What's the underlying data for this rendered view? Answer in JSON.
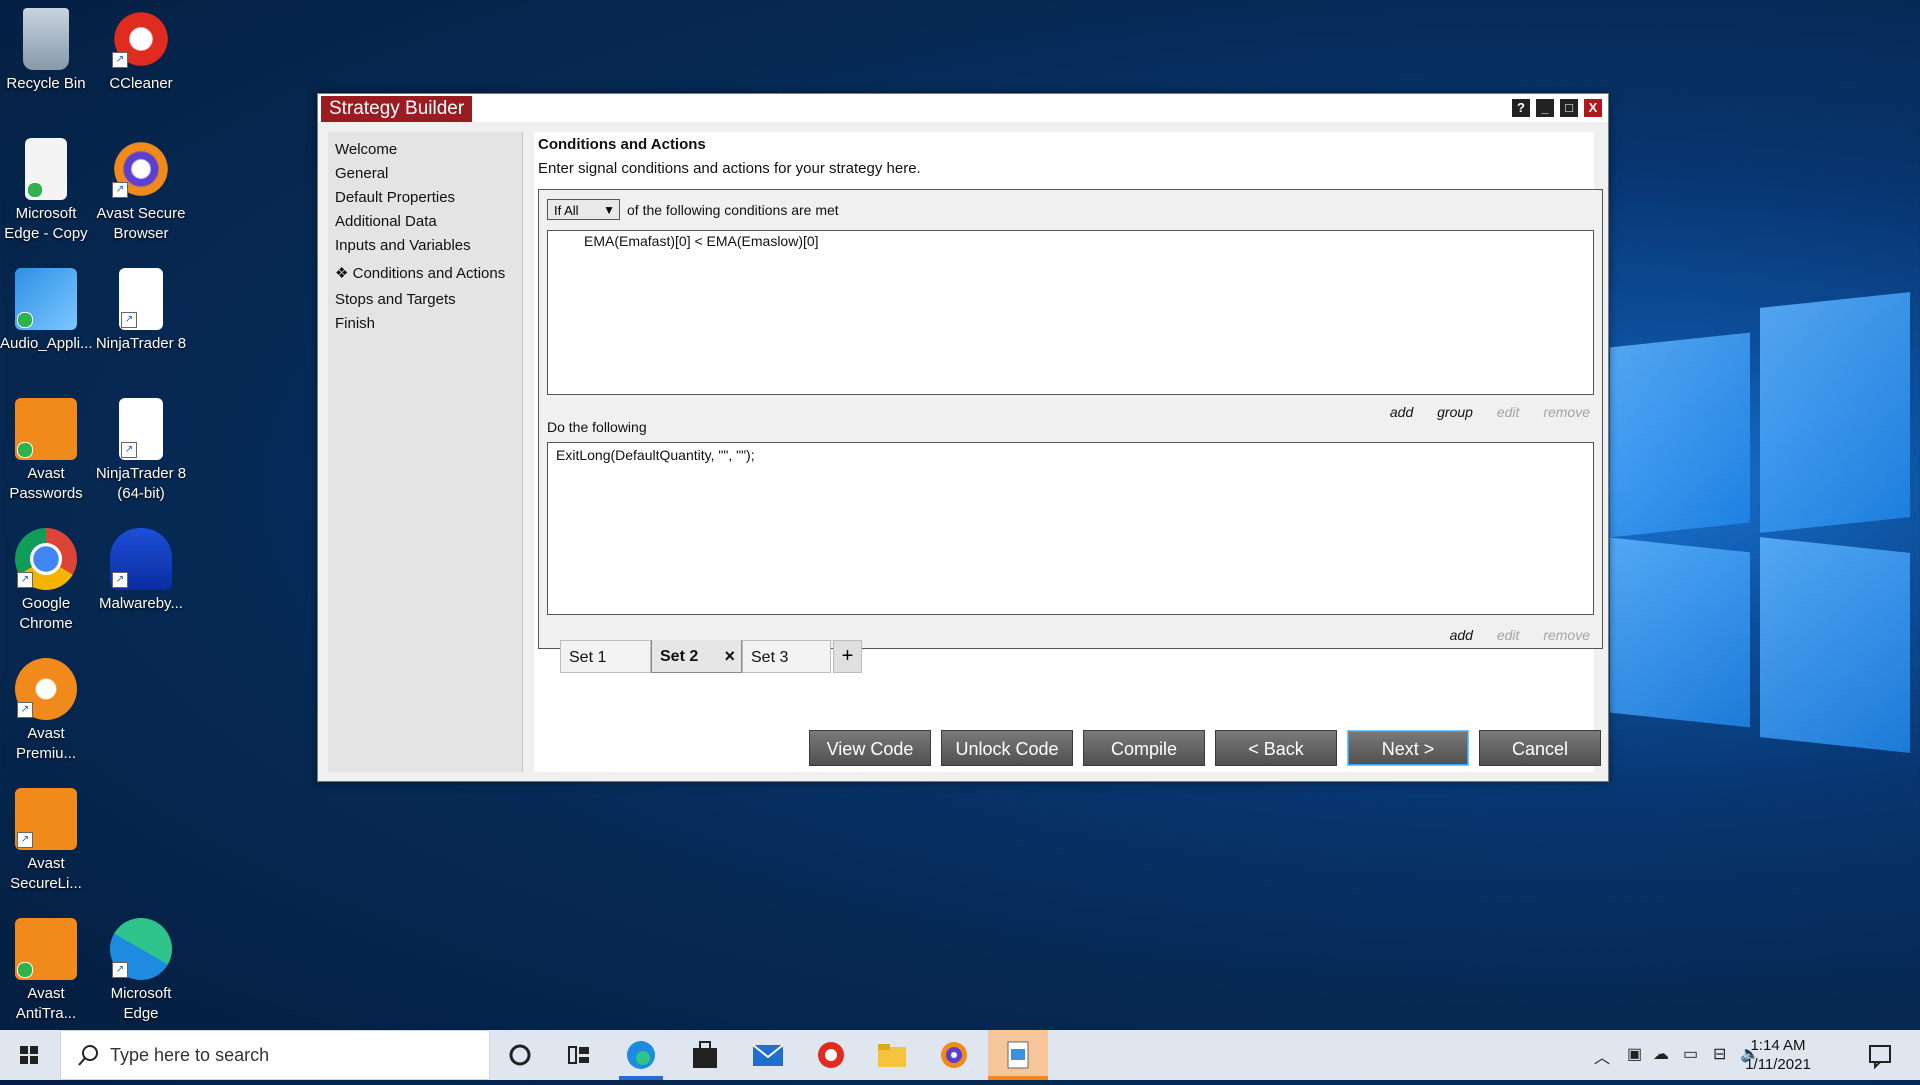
{
  "desktop": {
    "icons": [
      {
        "label": "Recycle Bin",
        "icon": "recycle-bin-icon"
      },
      {
        "label": "CCleaner",
        "icon": "ccleaner-icon"
      },
      {
        "label": "Microsoft Edge - Copy",
        "icon": "document-icon"
      },
      {
        "label": "Avast Secure Browser",
        "icon": "avast-browser-icon"
      },
      {
        "label": "Audio_Appli...",
        "icon": "audio-app-icon"
      },
      {
        "label": "NinjaTrader 8",
        "icon": "ninjatrader-icon"
      },
      {
        "label": "Avast Passwords",
        "icon": "avast-passwords-icon"
      },
      {
        "label": "NinjaTrader 8 (64-bit)",
        "icon": "ninjatrader-icon"
      },
      {
        "label": "Google Chrome",
        "icon": "chrome-icon"
      },
      {
        "label": "Malwareby...",
        "icon": "malwarebytes-icon"
      },
      {
        "label": "Avast Premiu...",
        "icon": "avast-icon"
      },
      {
        "label": "Avast SecureLi...",
        "icon": "avast-secureline-icon"
      },
      {
        "label": "Avast AntiTra...",
        "icon": "avast-antitrack-icon"
      },
      {
        "label": "Microsoft Edge",
        "icon": "edge-icon"
      }
    ]
  },
  "window": {
    "title": "Strategy Builder",
    "controls": {
      "help": "?",
      "minimize": "_",
      "maximize": "□",
      "close": "X"
    }
  },
  "nav": {
    "items": [
      "Welcome",
      "General",
      "Default Properties",
      "Additional Data",
      "Inputs and Variables",
      "❖ Conditions and Actions",
      "Stops and Targets",
      "Finish"
    ]
  },
  "content": {
    "title": "Conditions and Actions",
    "description": "Enter signal conditions and actions for your strategy here.",
    "condition_mode": "If All",
    "condition_label": "of the following conditions are met",
    "conditions": [
      "EMA(Emafast)[0] < EMA(Emaslow)[0]"
    ],
    "condition_links": [
      "add",
      "group",
      "edit",
      "remove"
    ],
    "do_label": "Do the following",
    "actions": [
      "ExitLong(DefaultQuantity, \"\", \"\");"
    ],
    "action_links": [
      "add",
      "edit",
      "remove"
    ],
    "sets": [
      "Set 1",
      "Set 2",
      "Set 3"
    ],
    "active_set": "Set 2",
    "set_close": "×",
    "add_set": "+"
  },
  "footer_buttons": [
    "View Code",
    "Unlock Code",
    "Compile",
    "< Back",
    "Next >",
    "Cancel"
  ],
  "taskbar": {
    "search_placeholder": "Type here to search",
    "time": "1:14 AM",
    "date": "1/11/2021"
  },
  "colors": {
    "title_accent": "#9b1b22",
    "button_gray": "#5f5f5f",
    "taskbar": "#dfe6ef"
  }
}
